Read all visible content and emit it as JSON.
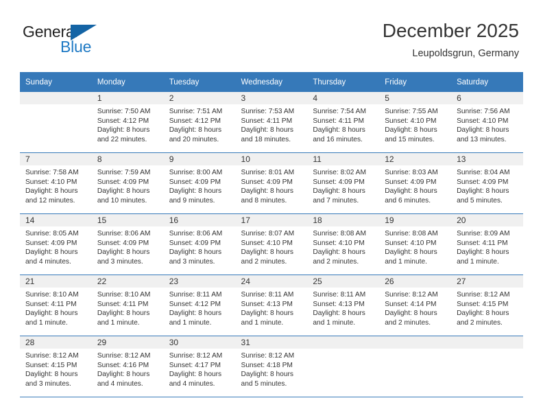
{
  "logo": {
    "word_one": "General",
    "word_two": "Blue",
    "icon": "triangle-logo-mark",
    "color_dark": "#222222",
    "color_blue": "#1f7ac4",
    "color_triangle": "#1464a5"
  },
  "header": {
    "title": "December 2025",
    "subtitle": "Leupoldsgrun, Germany"
  },
  "theme": {
    "header_row_bg": "#3679b9",
    "header_row_text": "#ffffff",
    "daynum_band_bg": "#f0f0f0",
    "grid_line": "#3679b9",
    "body_text": "#333333"
  },
  "calendar": {
    "weekday_headers": [
      "Sunday",
      "Monday",
      "Tuesday",
      "Wednesday",
      "Thursday",
      "Friday",
      "Saturday"
    ],
    "weeks": [
      [
        {
          "day": "",
          "lines": []
        },
        {
          "day": "1",
          "lines": [
            "Sunrise: 7:50 AM",
            "Sunset: 4:12 PM",
            "Daylight: 8 hours",
            "and 22 minutes."
          ]
        },
        {
          "day": "2",
          "lines": [
            "Sunrise: 7:51 AM",
            "Sunset: 4:12 PM",
            "Daylight: 8 hours",
            "and 20 minutes."
          ]
        },
        {
          "day": "3",
          "lines": [
            "Sunrise: 7:53 AM",
            "Sunset: 4:11 PM",
            "Daylight: 8 hours",
            "and 18 minutes."
          ]
        },
        {
          "day": "4",
          "lines": [
            "Sunrise: 7:54 AM",
            "Sunset: 4:11 PM",
            "Daylight: 8 hours",
            "and 16 minutes."
          ]
        },
        {
          "day": "5",
          "lines": [
            "Sunrise: 7:55 AM",
            "Sunset: 4:10 PM",
            "Daylight: 8 hours",
            "and 15 minutes."
          ]
        },
        {
          "day": "6",
          "lines": [
            "Sunrise: 7:56 AM",
            "Sunset: 4:10 PM",
            "Daylight: 8 hours",
            "and 13 minutes."
          ]
        }
      ],
      [
        {
          "day": "7",
          "lines": [
            "Sunrise: 7:58 AM",
            "Sunset: 4:10 PM",
            "Daylight: 8 hours",
            "and 12 minutes."
          ]
        },
        {
          "day": "8",
          "lines": [
            "Sunrise: 7:59 AM",
            "Sunset: 4:09 PM",
            "Daylight: 8 hours",
            "and 10 minutes."
          ]
        },
        {
          "day": "9",
          "lines": [
            "Sunrise: 8:00 AM",
            "Sunset: 4:09 PM",
            "Daylight: 8 hours",
            "and 9 minutes."
          ]
        },
        {
          "day": "10",
          "lines": [
            "Sunrise: 8:01 AM",
            "Sunset: 4:09 PM",
            "Daylight: 8 hours",
            "and 8 minutes."
          ]
        },
        {
          "day": "11",
          "lines": [
            "Sunrise: 8:02 AM",
            "Sunset: 4:09 PM",
            "Daylight: 8 hours",
            "and 7 minutes."
          ]
        },
        {
          "day": "12",
          "lines": [
            "Sunrise: 8:03 AM",
            "Sunset: 4:09 PM",
            "Daylight: 8 hours",
            "and 6 minutes."
          ]
        },
        {
          "day": "13",
          "lines": [
            "Sunrise: 8:04 AM",
            "Sunset: 4:09 PM",
            "Daylight: 8 hours",
            "and 5 minutes."
          ]
        }
      ],
      [
        {
          "day": "14",
          "lines": [
            "Sunrise: 8:05 AM",
            "Sunset: 4:09 PM",
            "Daylight: 8 hours",
            "and 4 minutes."
          ]
        },
        {
          "day": "15",
          "lines": [
            "Sunrise: 8:06 AM",
            "Sunset: 4:09 PM",
            "Daylight: 8 hours",
            "and 3 minutes."
          ]
        },
        {
          "day": "16",
          "lines": [
            "Sunrise: 8:06 AM",
            "Sunset: 4:09 PM",
            "Daylight: 8 hours",
            "and 3 minutes."
          ]
        },
        {
          "day": "17",
          "lines": [
            "Sunrise: 8:07 AM",
            "Sunset: 4:10 PM",
            "Daylight: 8 hours",
            "and 2 minutes."
          ]
        },
        {
          "day": "18",
          "lines": [
            "Sunrise: 8:08 AM",
            "Sunset: 4:10 PM",
            "Daylight: 8 hours",
            "and 2 minutes."
          ]
        },
        {
          "day": "19",
          "lines": [
            "Sunrise: 8:08 AM",
            "Sunset: 4:10 PM",
            "Daylight: 8 hours",
            "and 1 minute."
          ]
        },
        {
          "day": "20",
          "lines": [
            "Sunrise: 8:09 AM",
            "Sunset: 4:11 PM",
            "Daylight: 8 hours",
            "and 1 minute."
          ]
        }
      ],
      [
        {
          "day": "21",
          "lines": [
            "Sunrise: 8:10 AM",
            "Sunset: 4:11 PM",
            "Daylight: 8 hours",
            "and 1 minute."
          ]
        },
        {
          "day": "22",
          "lines": [
            "Sunrise: 8:10 AM",
            "Sunset: 4:11 PM",
            "Daylight: 8 hours",
            "and 1 minute."
          ]
        },
        {
          "day": "23",
          "lines": [
            "Sunrise: 8:11 AM",
            "Sunset: 4:12 PM",
            "Daylight: 8 hours",
            "and 1 minute."
          ]
        },
        {
          "day": "24",
          "lines": [
            "Sunrise: 8:11 AM",
            "Sunset: 4:13 PM",
            "Daylight: 8 hours",
            "and 1 minute."
          ]
        },
        {
          "day": "25",
          "lines": [
            "Sunrise: 8:11 AM",
            "Sunset: 4:13 PM",
            "Daylight: 8 hours",
            "and 1 minute."
          ]
        },
        {
          "day": "26",
          "lines": [
            "Sunrise: 8:12 AM",
            "Sunset: 4:14 PM",
            "Daylight: 8 hours",
            "and 2 minutes."
          ]
        },
        {
          "day": "27",
          "lines": [
            "Sunrise: 8:12 AM",
            "Sunset: 4:15 PM",
            "Daylight: 8 hours",
            "and 2 minutes."
          ]
        }
      ],
      [
        {
          "day": "28",
          "lines": [
            "Sunrise: 8:12 AM",
            "Sunset: 4:15 PM",
            "Daylight: 8 hours",
            "and 3 minutes."
          ]
        },
        {
          "day": "29",
          "lines": [
            "Sunrise: 8:12 AM",
            "Sunset: 4:16 PM",
            "Daylight: 8 hours",
            "and 4 minutes."
          ]
        },
        {
          "day": "30",
          "lines": [
            "Sunrise: 8:12 AM",
            "Sunset: 4:17 PM",
            "Daylight: 8 hours",
            "and 4 minutes."
          ]
        },
        {
          "day": "31",
          "lines": [
            "Sunrise: 8:12 AM",
            "Sunset: 4:18 PM",
            "Daylight: 8 hours",
            "and 5 minutes."
          ]
        },
        {
          "day": "",
          "lines": []
        },
        {
          "day": "",
          "lines": []
        },
        {
          "day": "",
          "lines": []
        }
      ]
    ]
  }
}
